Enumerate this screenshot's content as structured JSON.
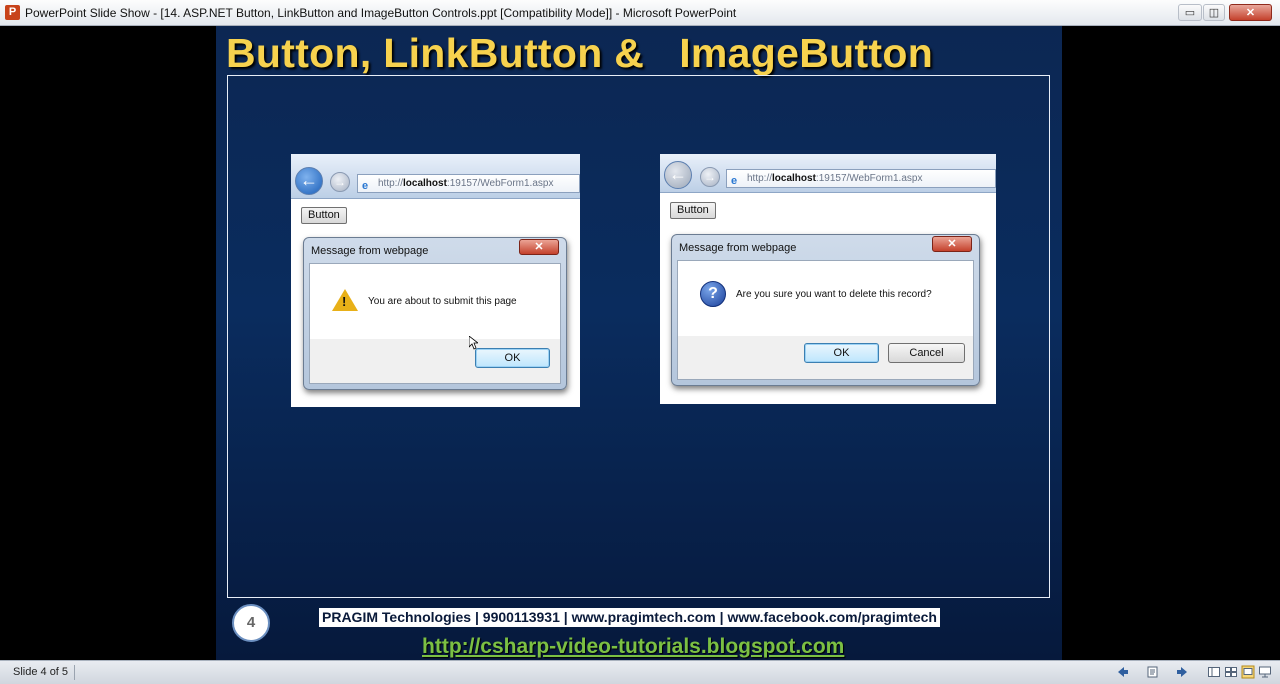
{
  "window": {
    "app_icon_letter": "P",
    "title": "PowerPoint Slide Show - [14. ASP.NET Button, LinkButton and ImageButton Controls.ppt [Compatibility Mode]] - Microsoft PowerPoint",
    "minimize_glyph": "▭",
    "maximize_glyph": "◫",
    "close_glyph": "✕"
  },
  "slide": {
    "title": "Button, LinkButton &   ImageButton",
    "number": "4",
    "footer_banner": "PRAGIM Technologies | 9900113931 | www.pragimtech.com | www.facebook.com/pragimtech",
    "footer_url": "http://csharp-video-tutorials.blogspot.com"
  },
  "screenshot_left": {
    "address_host": "localhost",
    "address_prefix": "http://",
    "address_suffix": ":19157/WebForm1.aspx",
    "page_button": "Button",
    "dialog_title": "Message from webpage",
    "message": "You are about to submit this page",
    "ok_label": "OK"
  },
  "screenshot_right": {
    "address_host": "localhost",
    "address_prefix": "http://",
    "address_suffix": ":19157/WebForm1.aspx",
    "page_button": "Button",
    "dialog_title": "Message from webpage",
    "message": "Are you sure you want to delete this record?",
    "ok_label": "OK",
    "cancel_label": "Cancel"
  },
  "statusbar": {
    "slide_indicator": "Slide 4 of 5"
  },
  "icons": {
    "back": "←",
    "forward": "→",
    "warning_mark": "!",
    "question_mark": "?",
    "ie": "e",
    "dialog_close": "✕"
  },
  "colors": {
    "title_yellow": "#f7d24e",
    "slide_blue": "#0a2c5e",
    "url_green": "#7bc043"
  }
}
